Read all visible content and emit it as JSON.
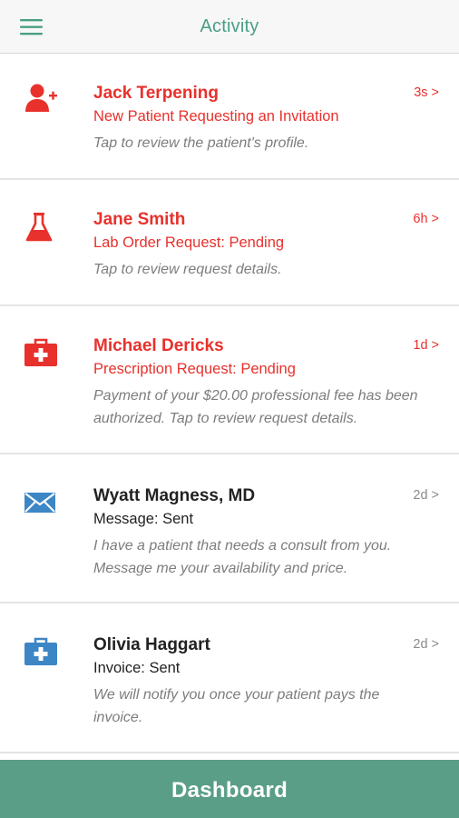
{
  "header": {
    "title": "Activity",
    "menu_icon": "hamburger-menu-icon"
  },
  "activity": [
    {
      "name": "Jack Terpening",
      "subtitle": "New Patient Requesting an Invitation",
      "description": "Tap to review the patient's profile.",
      "time": "3s >",
      "icon": "add-user-icon",
      "status_color": "#e8312c"
    },
    {
      "name": "Jane Smith",
      "subtitle": "Lab Order Request: Pending",
      "description": "Tap to review request details.",
      "time": "6h >",
      "icon": "lab-flask-icon",
      "status_color": "#e8312c"
    },
    {
      "name": "Michael Dericks",
      "subtitle": "Prescription Request: Pending",
      "description": "Payment of your $20.00 professional fee has been authorized. Tap to review request details.",
      "time": "1d >",
      "icon": "medical-kit-icon",
      "status_color": "#e8312c"
    },
    {
      "name": "Wyatt Magness, MD",
      "subtitle": "Message: Sent",
      "description": "I have a patient that needs a consult from you. Message me your availability and price.",
      "time": "2d >",
      "icon": "envelope-icon",
      "status_color": "#222222"
    },
    {
      "name": "Olivia Haggart",
      "subtitle": "Invoice: Sent",
      "description": "We will notify you once your patient pays the invoice.",
      "time": "2d >",
      "icon": "medical-kit-icon",
      "status_color": "#222222"
    }
  ],
  "footer": {
    "button_label": "Dashboard"
  },
  "colors": {
    "accent": "#5a9e88",
    "alert": "#e8312c",
    "icon_blue": "#3d86c6"
  }
}
